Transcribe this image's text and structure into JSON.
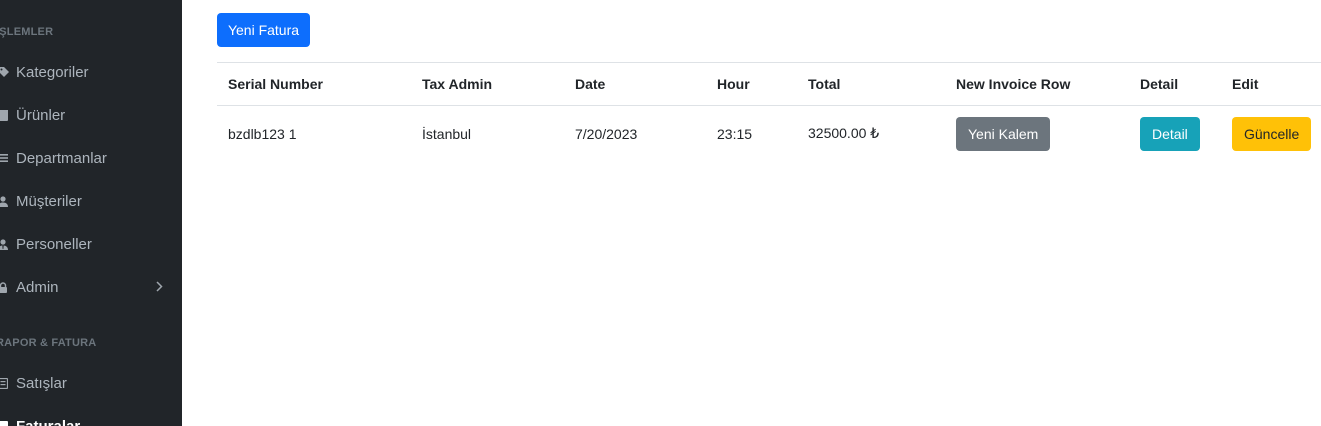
{
  "sidebar": {
    "section1": "İŞLEMLER",
    "items1": [
      {
        "label": "Kategoriler",
        "icon": "tags-icon"
      },
      {
        "label": "Ürünler",
        "icon": "box-icon"
      },
      {
        "label": "Departmanlar",
        "icon": "list-icon"
      },
      {
        "label": "Müşteriler",
        "icon": "user-icon"
      },
      {
        "label": "Personeller",
        "icon": "user-tie-icon"
      },
      {
        "label": "Admin",
        "icon": "lock-icon"
      }
    ],
    "section2": "RAPOR & FATURA",
    "items2": [
      {
        "label": "Satışlar",
        "icon": "receipt-icon"
      },
      {
        "label": "Faturalar",
        "icon": "invoice-icon"
      }
    ]
  },
  "main": {
    "new_invoice_button": "Yeni Fatura",
    "table": {
      "headers": [
        "Serial Number",
        "Tax Admin",
        "Date",
        "Hour",
        "Total",
        "New Invoice Row",
        "Detail",
        "Edit"
      ],
      "rows": [
        {
          "serial": "bzdlb123 1",
          "tax_admin": "İstanbul",
          "date": "7/20/2023",
          "hour": "23:15",
          "total": "32500.00 ₺",
          "new_row_button": "Yeni Kalem",
          "detail_button": "Detail",
          "edit_button": "Güncelle"
        }
      ]
    }
  },
  "colors": {
    "sidebar_bg": "#212529",
    "primary": "#0d6efd",
    "secondary": "#6c757d",
    "info": "#17a2b8",
    "warning": "#ffc107"
  }
}
